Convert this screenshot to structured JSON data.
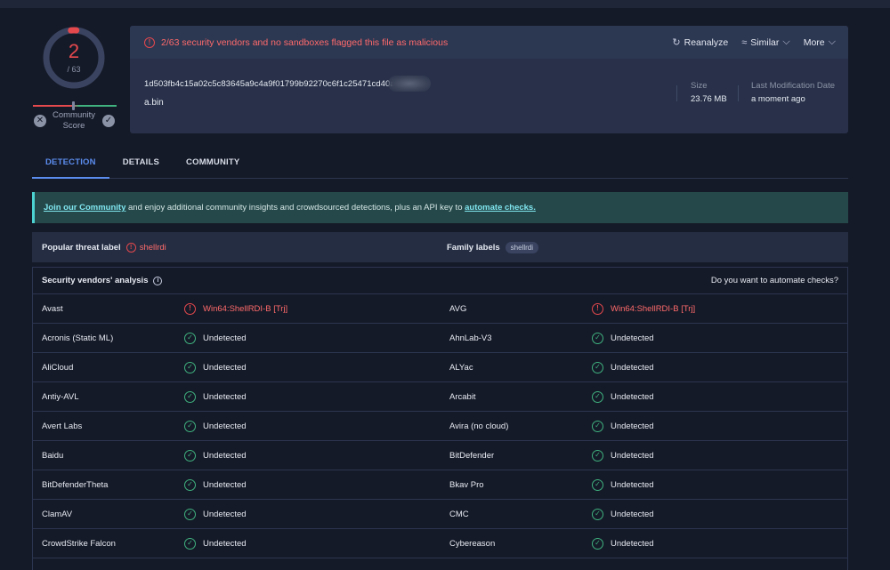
{
  "score": {
    "value": "2",
    "total": "/ 63",
    "label_line1": "Community",
    "label_line2": "Score",
    "down_icon": "close-icon",
    "up_icon": "check-icon"
  },
  "card": {
    "alert": "2/63 security vendors and no sandboxes flagged this file as malicious",
    "actions": {
      "reanalyze": "Reanalyze",
      "similar": "Similar",
      "more": "More"
    },
    "hash": "1d503fb4c15a02c5c83645a9c4a9f01799b92270c6f1c25471cd40aec",
    "filename": "a.bin",
    "size_label": "Size",
    "size_value": "23.76 MB",
    "mod_label": "Last Modification Date",
    "mod_value": "a moment ago"
  },
  "tabs": [
    "DETECTION",
    "DETAILS",
    "COMMUNITY"
  ],
  "banner": {
    "link1": "Join our Community",
    "text": " and enjoy additional community insights and crowdsourced detections, plus an API key to ",
    "link2": "automate checks."
  },
  "threat": {
    "popular_label": "Popular threat label",
    "popular_value": "shellrdi",
    "family_label": "Family labels",
    "family_value": "shellrdi"
  },
  "vendors": {
    "title": "Security vendors' analysis",
    "automate": "Do you want to automate checks?",
    "rows": [
      {
        "left": "Avast",
        "left_result": "Win64:ShellRDI-B [Trj]",
        "left_bad": true,
        "right": "AVG",
        "right_result": "Win64:ShellRDI-B [Trj]",
        "right_bad": true
      },
      {
        "left": "Acronis (Static ML)",
        "left_result": "Undetected",
        "left_bad": false,
        "right": "AhnLab-V3",
        "right_result": "Undetected",
        "right_bad": false
      },
      {
        "left": "AliCloud",
        "left_result": "Undetected",
        "left_bad": false,
        "right": "ALYac",
        "right_result": "Undetected",
        "right_bad": false
      },
      {
        "left": "Antiy-AVL",
        "left_result": "Undetected",
        "left_bad": false,
        "right": "Arcabit",
        "right_result": "Undetected",
        "right_bad": false
      },
      {
        "left": "Avert Labs",
        "left_result": "Undetected",
        "left_bad": false,
        "right": "Avira (no cloud)",
        "right_result": "Undetected",
        "right_bad": false
      },
      {
        "left": "Baidu",
        "left_result": "Undetected",
        "left_bad": false,
        "right": "BitDefender",
        "right_result": "Undetected",
        "right_bad": false
      },
      {
        "left": "BitDefenderTheta",
        "left_result": "Undetected",
        "left_bad": false,
        "right": "Bkav Pro",
        "right_result": "Undetected",
        "right_bad": false
      },
      {
        "left": "ClamAV",
        "left_result": "Undetected",
        "left_bad": false,
        "right": "CMC",
        "right_result": "Undetected",
        "right_bad": false
      },
      {
        "left": "CrowdStrike Falcon",
        "left_result": "Undetected",
        "left_bad": false,
        "right": "Cybereason",
        "right_result": "Undetected",
        "right_bad": false
      },
      {
        "left": "",
        "left_result": "",
        "left_bad": false,
        "right": "",
        "right_result": "",
        "right_bad": false
      }
    ]
  },
  "colors": {
    "malicious": "#e5484d",
    "clean": "#3fb27f",
    "accent": "#5b8def",
    "banner_bg": "#25494a"
  }
}
